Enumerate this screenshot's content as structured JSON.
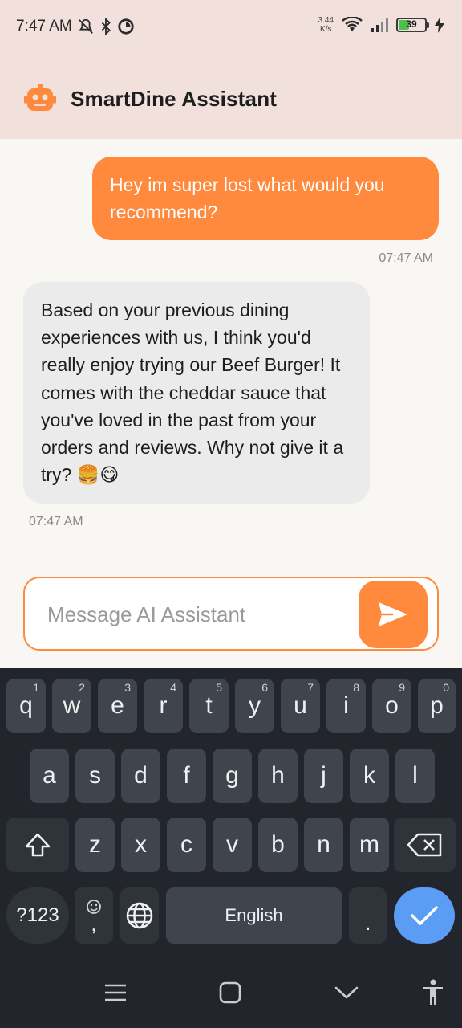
{
  "status_bar": {
    "time": "7:47 AM",
    "net_speed_value": "3.44",
    "net_speed_unit": "K/s",
    "battery": "39",
    "icons": [
      "mute-icon",
      "bluetooth-icon",
      "vpn-icon",
      "wifi-icon",
      "signal-icon",
      "battery-icon",
      "charging-icon"
    ]
  },
  "app_bar": {
    "title": "SmartDine Assistant",
    "logo_icon": "robot-icon",
    "accent_color": "#ff8a3d"
  },
  "messages": [
    {
      "sender": "user",
      "text": "Hey im super lost what would you recommend?",
      "time": "07:47 AM"
    },
    {
      "sender": "assistant",
      "text": "Based on your previous dining experiences with us, I think you'd really enjoy trying our Beef Burger! It comes with the cheddar sauce that you've loved in the past from your orders and reviews. Why not give it a try? 🍔😋",
      "time": "07:47 AM"
    }
  ],
  "composer": {
    "placeholder": "Message AI Assistant",
    "send_icon": "send-icon"
  },
  "keyboard": {
    "row1": [
      {
        "key": "q",
        "hint": "1"
      },
      {
        "key": "w",
        "hint": "2"
      },
      {
        "key": "e",
        "hint": "3"
      },
      {
        "key": "r",
        "hint": "4"
      },
      {
        "key": "t",
        "hint": "5"
      },
      {
        "key": "y",
        "hint": "6"
      },
      {
        "key": "u",
        "hint": "7"
      },
      {
        "key": "i",
        "hint": "8"
      },
      {
        "key": "o",
        "hint": "9"
      },
      {
        "key": "p",
        "hint": "0"
      }
    ],
    "row2": [
      "a",
      "s",
      "d",
      "f",
      "g",
      "h",
      "j",
      "k",
      "l"
    ],
    "row3": [
      "z",
      "x",
      "c",
      "v",
      "b",
      "n",
      "m"
    ],
    "symbols_label": "?123",
    "comma_label": ",",
    "space_label": "English",
    "period_label": ".",
    "key_bg": "#40454d",
    "keyboard_bg": "#22262c",
    "enter_color": "#5b9cf4"
  },
  "nav_bar": {
    "icons": [
      "menu-icon",
      "home-icon",
      "hide-keyboard-icon",
      "accessibility-icon"
    ]
  }
}
